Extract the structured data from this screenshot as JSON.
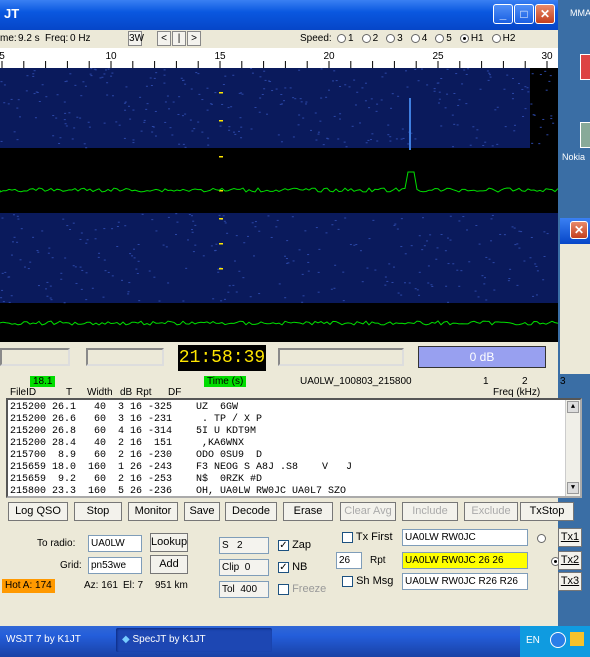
{
  "spec": {
    "title": "JT",
    "time_label": "me:",
    "time_value": "9.2 s",
    "freq_label": "Freq:",
    "freq_value": "0 Hz",
    "btn_3w": "3W",
    "btn_prev": "<",
    "btn_bar": "|",
    "btn_next": ">",
    "speed_label": "Speed:",
    "speeds": [
      "1",
      "2",
      "3",
      "4",
      "5",
      "H1",
      "H2"
    ],
    "speed_selected": "H1",
    "scale_labels": [
      "5",
      "10",
      "15",
      "20",
      "25",
      "30"
    ],
    "clock": "21:58:39",
    "db_text": "0 dB"
  },
  "desktop": {
    "label_top": "MMA",
    "label_nokia": "Nokia"
  },
  "wsjt": {
    "hdr_freq": "18.1",
    "hdr_fileid": "FileID",
    "hdr_t": "T",
    "hdr_width": "Width",
    "hdr_db": "dB",
    "hdr_rpt": "Rpt",
    "hdr_df": "DF",
    "hdr_time": "Time (s)",
    "hdr_file": "UA0LW_100803_215800",
    "hdr_1": "1",
    "hdr_2": "2",
    "hdr_3": "3",
    "hdr_freqkhz": "Freq (kHz)",
    "decode_lines": [
      "215200 26.1   40  3 16 -325    UZ  6GW",
      "215200 26.6   60  3 16 -231     . TP / X P",
      "215200 26.8   60  4 16 -314    5I U KDT9M",
      "215200 28.4   40  2 16  151     ,KA6WNX",
      "215700  8.9   60  2 16 -230    ODO 0SU9  D",
      "215659 18.0  160  1 26 -243    F3 NEOG S A8J .S8    V   J",
      "215659  9.2   60  2 16 -253    N$  0RZK #D",
      "215800 23.3  160  5 26 -236    OH, UA0LW RW0JC UA0L7 SZO"
    ],
    "buttons": [
      "Log QSO",
      "Stop",
      "Monitor",
      "Save",
      "Decode",
      "Erase",
      "Clear Avg",
      "Include",
      "Exclude",
      "TxStop"
    ],
    "to_radio_label": "To radio:",
    "to_radio_value": "UA0LW",
    "lookup": "Lookup",
    "grid_label": "Grid:",
    "grid_value": "pn53we",
    "add": "Add",
    "hot_a": "Hot A: 174",
    "az": "Az: 161",
    "el": "El: 7",
    "dist": "951 km",
    "s_label": "S",
    "s_value": "2",
    "clip_label": "Clip",
    "clip_value": "0",
    "tol_label": "Tol",
    "tol_value": "400",
    "zap": "Zap",
    "nb": "NB",
    "freeze": "Freeze",
    "tx_first": "Tx First",
    "rpt_value": "26",
    "rpt_label": "Rpt",
    "sh_msg": "Sh Msg",
    "tx1_msg": "UA0LW RW0JC",
    "tx2_msg": "UA0LW RW0JC 26 26",
    "tx3_msg": "UA0LW RW0JC R26 R26",
    "tx1": "Tx1",
    "tx2": "Tx2",
    "tx3": "Tx3"
  },
  "taskbar": {
    "item1": "WSJT 7   by K1JT",
    "item2": "SpecJT   by K1JT",
    "lang": "EN"
  },
  "colors": {
    "title_blue": "#0a58e0",
    "spectrum_green": "#00e000",
    "clock_yellow": "#ffe600",
    "highlight_yellow": "#ffff00",
    "hot_orange": "#ff9900",
    "status_green": "#00dd00"
  }
}
